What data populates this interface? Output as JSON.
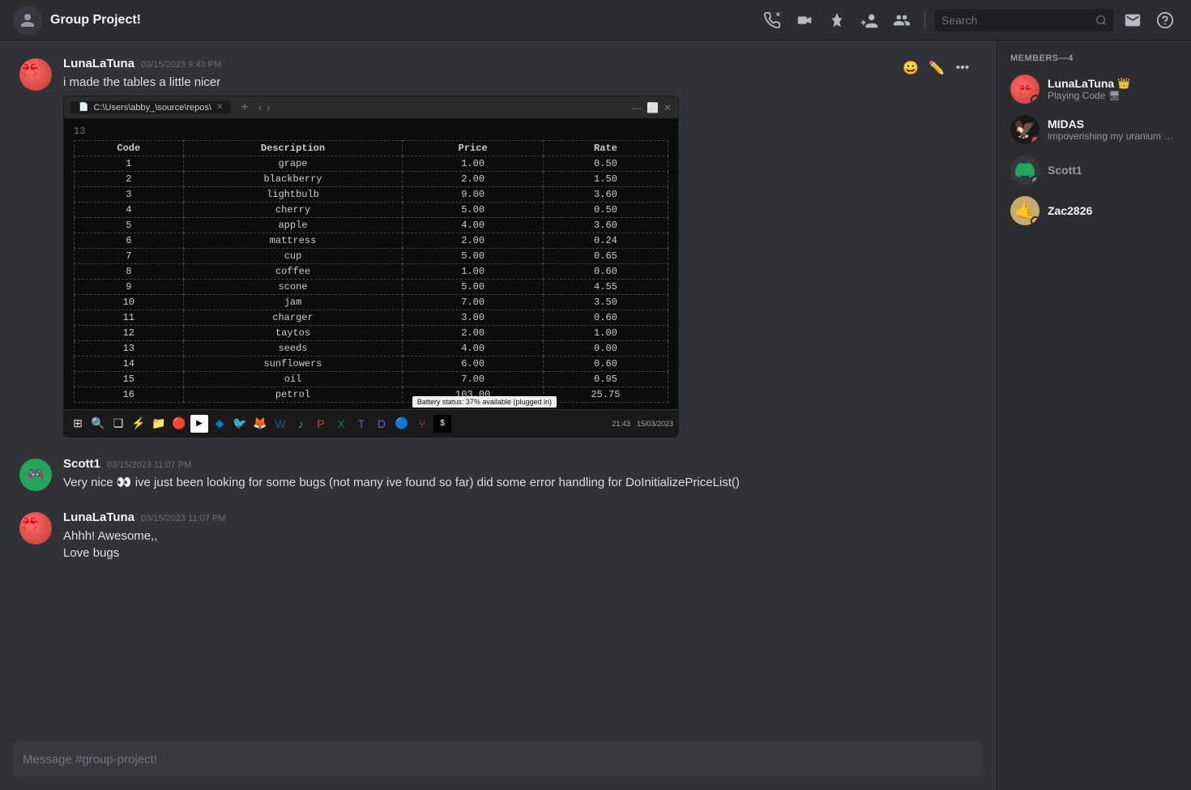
{
  "topbar": {
    "channel_icon": "👥",
    "title": "Group Project!",
    "search_placeholder": "Search",
    "icons": [
      "phone",
      "video",
      "pin",
      "add-member",
      "members"
    ]
  },
  "messages": [
    {
      "id": "msg1",
      "username": "LunaLaTuna",
      "timestamp": "03/15/2023 9:43 PM",
      "text": "i made the tables a little nicer",
      "avatar_type": "luna",
      "has_embed": true
    },
    {
      "id": "msg2",
      "username": "Scott1",
      "timestamp": "03/15/2023 11:07 PM",
      "text": "Very nice 👀 ive just been looking for some bugs (not many ive found so far) did some error handling for DoInitializePriceList()",
      "avatar_type": "scott"
    },
    {
      "id": "msg3",
      "username": "LunaLaTuna",
      "timestamp": "03/15/2023 11:07 PM",
      "text": "Ahhh! Awesome,,\nLove bugs",
      "avatar_type": "luna"
    }
  ],
  "terminal": {
    "tab_label": "C:\\Users\\abby_\\source\\repos\\",
    "line_number": "13",
    "headers": [
      "Code",
      "Description",
      "Price",
      "Rate"
    ],
    "rows": [
      [
        "1",
        "grape",
        "1.00",
        "0.50"
      ],
      [
        "2",
        "blackberry",
        "2.00",
        "1.50"
      ],
      [
        "3",
        "lightbulb",
        "9.00",
        "3.60"
      ],
      [
        "4",
        "cherry",
        "5.00",
        "0.50"
      ],
      [
        "5",
        "apple",
        "4.00",
        "3.60"
      ],
      [
        "6",
        "mattress",
        "2.00",
        "0.24"
      ],
      [
        "7",
        "cup",
        "5.00",
        "0.65"
      ],
      [
        "8",
        "coffee",
        "1.00",
        "0.60"
      ],
      [
        "9",
        "scone",
        "5.00",
        "4.55"
      ],
      [
        "10",
        "jam",
        "7.00",
        "3.50"
      ],
      [
        "11",
        "charger",
        "3.00",
        "0.60"
      ],
      [
        "12",
        "taytos",
        "2.00",
        "1.00"
      ],
      [
        "13",
        "seeds",
        "4.00",
        "0.00"
      ],
      [
        "14",
        "sunflowers",
        "6.00",
        "0.60"
      ],
      [
        "15",
        "oil",
        "7.00",
        "0.95"
      ],
      [
        "16",
        "petrol",
        "103.00",
        "25.75"
      ]
    ],
    "battery_text": "Battery status: 37% available (plugged in)",
    "time": "21:43",
    "date": "15/03/2023"
  },
  "members": {
    "header": "MEMBERS—4",
    "list": [
      {
        "name": "LunaLaTuna",
        "status": "dnd",
        "status_text": "Playing Code 🖥",
        "avatar_type": "luna",
        "is_crown": true
      },
      {
        "name": "MIDAS",
        "status": "dnd",
        "status_text": "impoverishing my uranium so i...",
        "avatar_type": "midas",
        "is_crown": false
      },
      {
        "name": "Scott1",
        "status": "offline",
        "status_text": "",
        "avatar_type": "scott_sidebar",
        "is_crown": false
      },
      {
        "name": "Zac2826",
        "status": "idle",
        "status_text": "",
        "avatar_type": "zac",
        "is_crown": false
      }
    ]
  },
  "message_actions": {
    "emoji": "😀",
    "edit": "✏",
    "more": "•••"
  },
  "input_placeholder": "Message #group-project!"
}
